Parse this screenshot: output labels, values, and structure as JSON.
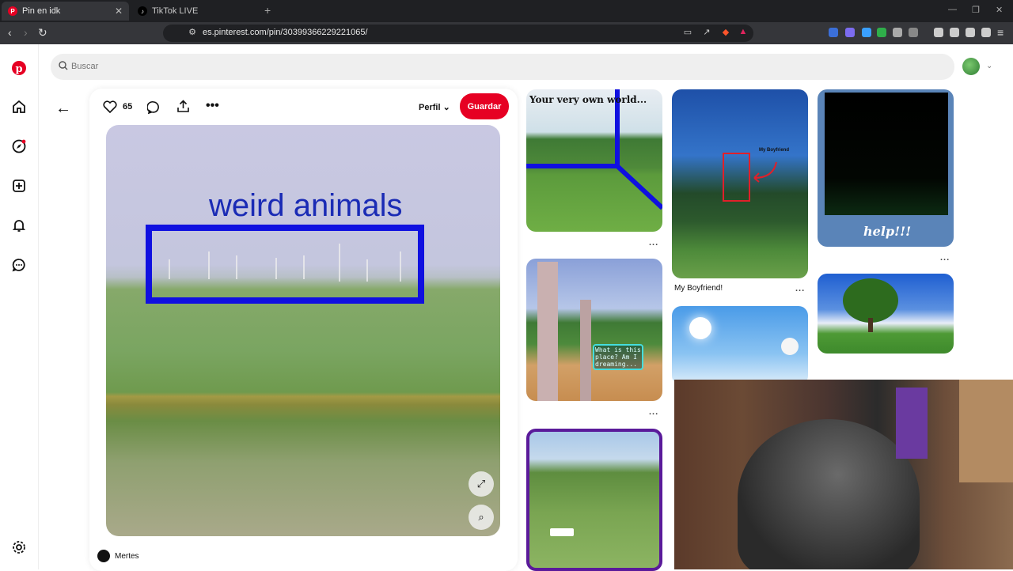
{
  "browser": {
    "tabs": [
      {
        "label": "Pin en idk",
        "active": true
      },
      {
        "label": "TikTok LIVE",
        "active": false
      }
    ],
    "url": "es.pinterest.com/pin/30399366229221065/"
  },
  "search": {
    "placeholder": "Buscar"
  },
  "pin": {
    "likes": "65",
    "profile_label": "Perfil",
    "save_label": "Guardar",
    "image_text": "weird animals",
    "author": "Mertes"
  },
  "grid": {
    "col1": [
      {
        "caption_overlay": "Your very own world..."
      },
      {
        "caption_overlay": "What is this place? Am I dreaming..."
      },
      {
        "caption_overlay": ""
      }
    ],
    "col2": [
      {
        "title": "My Boyfriend!",
        "overlay": "My Boyfriend"
      },
      {
        "title": ""
      }
    ],
    "col3": [
      {
        "caption_overlay": "help!!!"
      },
      {
        "caption_overlay": ""
      }
    ],
    "more_label": "..."
  },
  "colors": {
    "brand": "#e60023",
    "accent_blue": "#1010e0"
  }
}
